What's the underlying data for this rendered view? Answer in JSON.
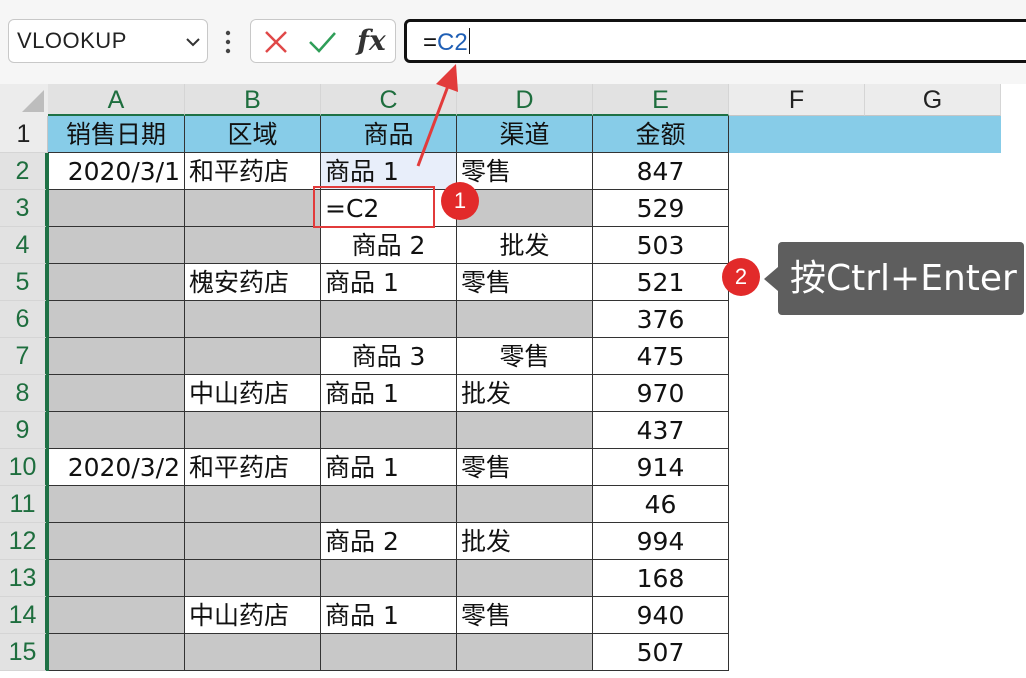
{
  "formula_bar": {
    "name_box": "VLOOKUP",
    "cancel_icon": "x-icon",
    "confirm_icon": "check-icon",
    "fx_label": "fx",
    "formula_prefix": "=",
    "formula_ref": "C2"
  },
  "columns": [
    "A",
    "B",
    "C",
    "D",
    "E",
    "F",
    "G"
  ],
  "rows": [
    "1",
    "2",
    "3",
    "4",
    "5",
    "6",
    "7",
    "8",
    "9",
    "10",
    "11",
    "12",
    "13",
    "14",
    "15"
  ],
  "header_row": [
    "销售日期",
    "区域",
    "商品",
    "渠道",
    "金额"
  ],
  "data": [
    {
      "a": "2020/3/1",
      "b": "和平药店",
      "c": "商品 1",
      "d": "零售",
      "e": "847"
    },
    {
      "a": "",
      "b": "",
      "c": "=C2",
      "d": "",
      "e": "529"
    },
    {
      "a": "",
      "b": "",
      "c": "商品 2",
      "d": "批发",
      "e": "503"
    },
    {
      "a": "",
      "b": "槐安药店",
      "c": "商品 1",
      "d": "零售",
      "e": "521"
    },
    {
      "a": "",
      "b": "",
      "c": "",
      "d": "",
      "e": "376"
    },
    {
      "a": "",
      "b": "",
      "c": "商品 3",
      "d": "零售",
      "e": "475"
    },
    {
      "a": "",
      "b": "中山药店",
      "c": "商品 1",
      "d": "批发",
      "e": "970"
    },
    {
      "a": "",
      "b": "",
      "c": "",
      "d": "",
      "e": "437"
    },
    {
      "a": "2020/3/2",
      "b": "和平药店",
      "c": "商品 1",
      "d": "零售",
      "e": "914"
    },
    {
      "a": "",
      "b": "",
      "c": "",
      "d": "",
      "e": "46"
    },
    {
      "a": "",
      "b": "",
      "c": "商品 2",
      "d": "批发",
      "e": "994"
    },
    {
      "a": "",
      "b": "",
      "c": "",
      "d": "",
      "e": "168"
    },
    {
      "a": "",
      "b": "中山药店",
      "c": "商品 1",
      "d": "零售",
      "e": "940"
    },
    {
      "a": "",
      "b": "",
      "c": "",
      "d": "",
      "e": "507"
    }
  ],
  "annotations": {
    "badge1": "1",
    "badge2": "2",
    "callout_text": "按Ctrl+Enter"
  },
  "colors": {
    "header_fill": "#87cce8",
    "blank_fill": "#c8c8c8",
    "selection_green": "#1e7145",
    "annotation_red": "#e23b3b",
    "callout_bg": "#5e5e5e"
  }
}
